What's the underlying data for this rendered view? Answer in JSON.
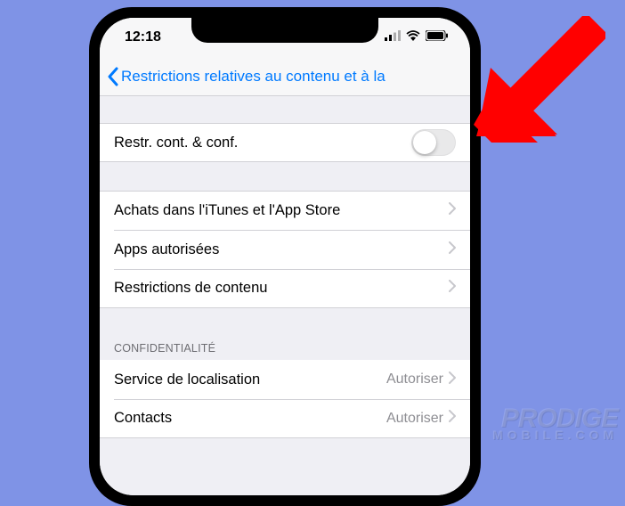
{
  "statusbar": {
    "time": "12:18"
  },
  "navbar": {
    "back_label": "Restrictions relatives au contenu et à la"
  },
  "group1": {
    "row_toggle": {
      "label": "Restr. cont. & conf.",
      "on": false
    }
  },
  "group2": {
    "rows": [
      {
        "label": "Achats dans l'iTunes et l'App Store"
      },
      {
        "label": "Apps autorisées"
      },
      {
        "label": "Restrictions de contenu"
      }
    ]
  },
  "group3": {
    "header": "CONFIDENTIALITÉ",
    "rows": [
      {
        "label": "Service de localisation",
        "value": "Autoriser"
      },
      {
        "label": "Contacts",
        "value": "Autoriser"
      }
    ]
  },
  "watermark": {
    "line1": "PRODIGE",
    "line2": "MOBILE.COM"
  }
}
